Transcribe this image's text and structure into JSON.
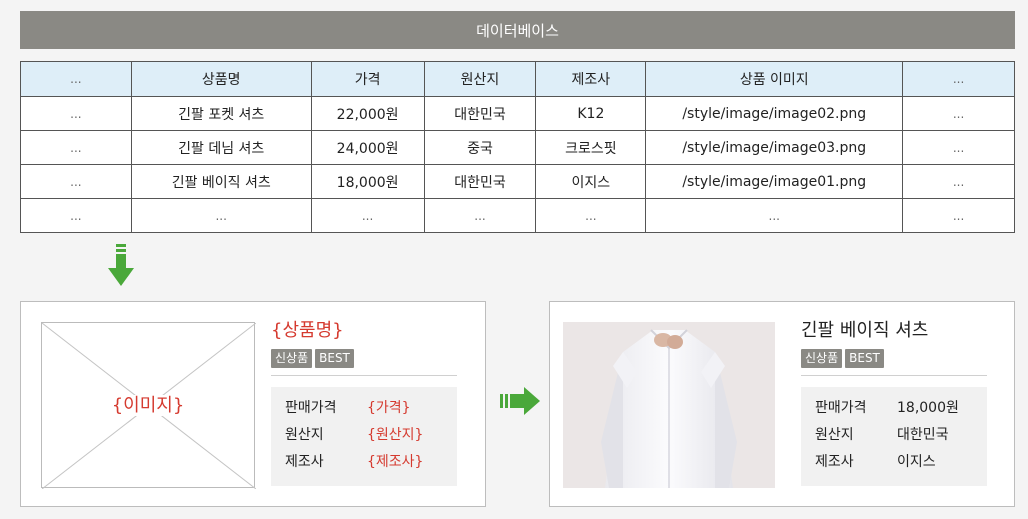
{
  "database": {
    "title": "데이터베이스",
    "columns": [
      "...",
      "상품명",
      "가격",
      "원산지",
      "제조사",
      "상품 이미지",
      "..."
    ],
    "rows": [
      [
        "...",
        "긴팔 포켓 셔츠",
        "22,000원",
        "대한민국",
        "K12",
        "/style/image/image02.png",
        "..."
      ],
      [
        "...",
        "긴팔 데님 셔츠",
        "24,000원",
        "중국",
        "크로스핏",
        "/style/image/image03.png",
        "..."
      ],
      [
        "...",
        "긴팔 베이직 셔츠",
        "18,000원",
        "대한민국",
        "이지스",
        "/style/image/image01.png",
        "..."
      ],
      [
        "...",
        "...",
        "...",
        "...",
        "...",
        "...",
        "..."
      ]
    ]
  },
  "template_card": {
    "image_placeholder": "{이미지}",
    "title": "{상품명}",
    "badges": [
      "신상품",
      "BEST"
    ],
    "specs": [
      {
        "key": "판매가격",
        "value": "{가격}"
      },
      {
        "key": "원산지",
        "value": "{원산지}"
      },
      {
        "key": "제조사",
        "value": "{제조사}"
      }
    ]
  },
  "result_card": {
    "title": "긴팔 베이직 셔츠",
    "badges": [
      "신상품",
      "BEST"
    ],
    "specs": [
      {
        "key": "판매가격",
        "value": "18,000원"
      },
      {
        "key": "원산지",
        "value": "대한민국"
      },
      {
        "key": "제조사",
        "value": "이지스"
      }
    ]
  },
  "colors": {
    "header_bg": "#8a8984",
    "table_head_bg": "#deeef8",
    "placeholder_text": "#d53a2f",
    "arrow_green": "#4aa83a"
  },
  "icons": {
    "down_arrow": "down-arrow-icon",
    "right_arrow": "right-arrow-icon"
  }
}
